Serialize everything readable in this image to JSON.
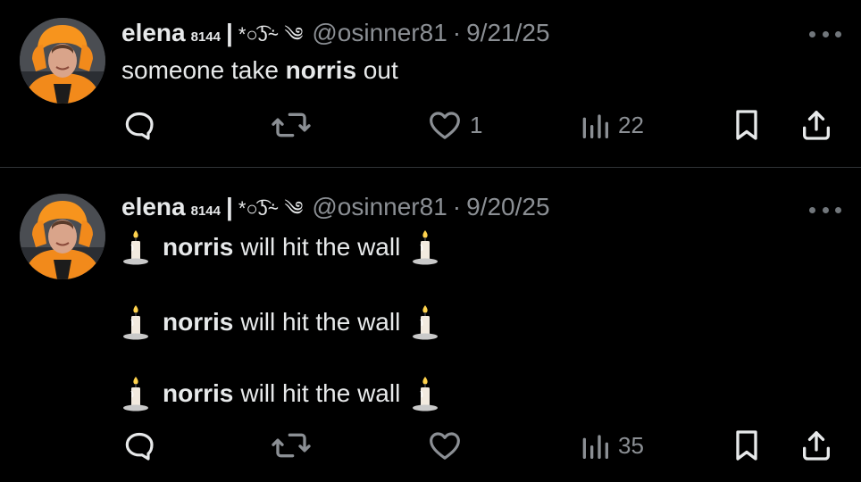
{
  "tweets": [
    {
      "author": {
        "name": "elena",
        "sup": "81",
        "sub": "44",
        "separator": "|",
        "deco": "*○͡ʖ⸞ ༄",
        "handle": "@osinner81",
        "dot": "·",
        "date": "9/21/25"
      },
      "body": {
        "prefix": "someone take ",
        "bold": "norris",
        "suffix": " out"
      },
      "actions": {
        "reply": "",
        "retweet": "",
        "like": "1",
        "views": "22"
      }
    },
    {
      "author": {
        "name": "elena",
        "sup": "81",
        "sub": "44",
        "separator": "|",
        "deco": "*○͡ʖ⸞ ༄",
        "handle": "@osinner81",
        "dot": "·",
        "date": "9/20/25"
      },
      "lines": [
        {
          "bold": "norris",
          "rest": "will hit the wall"
        },
        {
          "bold": "norris",
          "rest": "will hit the wall"
        },
        {
          "bold": "norris",
          "rest": "will hit the wall"
        }
      ],
      "actions": {
        "reply": "",
        "retweet": "",
        "like": "",
        "views": "35"
      }
    }
  ],
  "icons": {
    "reply": "reply-icon",
    "retweet": "retweet-icon",
    "like": "heart-icon",
    "views": "views-icon",
    "bookmark": "bookmark-icon",
    "share": "share-icon",
    "more": "more-icon",
    "candle": "candle-emoji"
  },
  "colors": {
    "background": "#000000",
    "text": "#e7e9ea",
    "muted": "#8b8f94",
    "divider": "#2f3336",
    "avatar_accent": "#f28a1b"
  }
}
